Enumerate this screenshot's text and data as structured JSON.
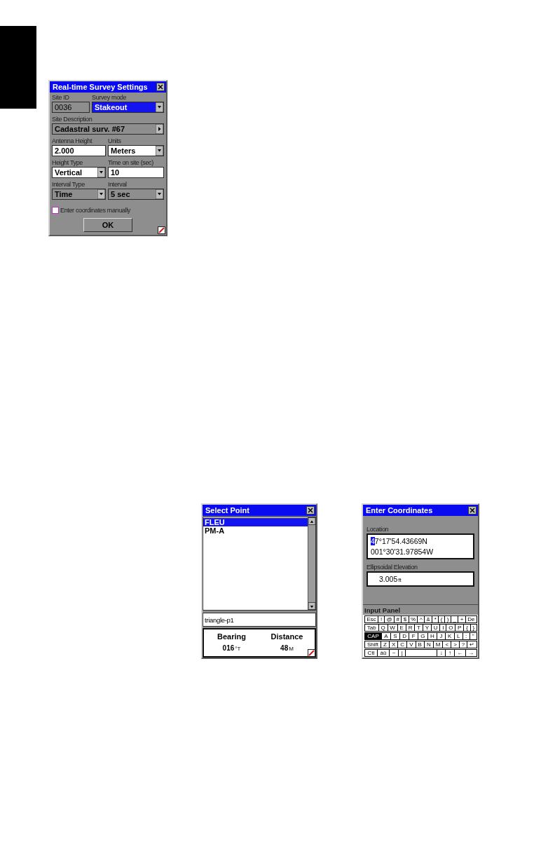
{
  "survey_settings": {
    "title": "Real-time Survey Settings",
    "rows": [
      [
        {
          "label": "Site ID",
          "value": "0036",
          "kind": "text",
          "disabled": true,
          "focused": false
        },
        {
          "label": "Survey mode",
          "value": "Stakeout",
          "kind": "dropdown",
          "disabled": false,
          "focused": true
        }
      ],
      [
        {
          "label": "Site Description",
          "value": "Cadastral surv. #67",
          "kind": "picker",
          "disabled": true,
          "focused": false
        }
      ],
      [
        {
          "label": "Antenna Height",
          "value": "2.000",
          "kind": "text",
          "disabled": false,
          "focused": false
        },
        {
          "label": "Units",
          "value": "Meters",
          "kind": "dropdown",
          "disabled": false,
          "focused": false
        }
      ],
      [
        {
          "label": "Height Type",
          "value": "Vertical",
          "kind": "dropdown",
          "disabled": false,
          "focused": false
        },
        {
          "label": "Time on site (sec)",
          "value": "10",
          "kind": "text",
          "disabled": false,
          "focused": false
        }
      ],
      [
        {
          "label": "Interval Type",
          "value": "Time",
          "kind": "dropdown",
          "disabled": true,
          "focused": false
        },
        {
          "label": "Interval",
          "value": "5 sec",
          "kind": "dropdown",
          "disabled": true,
          "focused": false
        }
      ]
    ],
    "checkbox": {
      "label": "Enter coordinates manually",
      "checked": false
    },
    "button": "OK"
  },
  "select_point": {
    "title": "Select Point",
    "points": [
      {
        "label": "FLEU",
        "selected": true
      },
      {
        "label": "PM-A",
        "selected": false
      }
    ],
    "name_field": {
      "value": "triangle-p1"
    },
    "readouts": [
      {
        "label": "Bearing",
        "value": "016",
        "unit": "°T"
      },
      {
        "label": "Distance",
        "value": "48",
        "unit": "M"
      }
    ]
  },
  "enter_coordinates": {
    "title": "Enter Coordinates",
    "location": {
      "label": "Location",
      "lines": [
        {
          "text": "47°17'54.43669N",
          "cursor": true
        },
        {
          "text": "001°30'31.97854W",
          "cursor": false
        }
      ]
    },
    "elevation": {
      "label": "Ellipsoidal Elevation",
      "value": "3.005",
      "unit": "ft"
    },
    "input_panel": {
      "title": "Input Panel",
      "key_rows": [
        {
          "keys": [
            {
              "kind": "key",
              "label": "Esc",
              "selected": false
            },
            {
              "kind": "key",
              "label": "!",
              "selected": false
            },
            {
              "kind": "key",
              "label": "@",
              "selected": false
            },
            {
              "kind": "key",
              "label": "#",
              "selected": false
            },
            {
              "kind": "key",
              "label": "$",
              "selected": false
            },
            {
              "kind": "key",
              "label": "%",
              "selected": false
            },
            {
              "kind": "key",
              "label": "^",
              "selected": false
            },
            {
              "kind": "key",
              "label": "&",
              "selected": false
            },
            {
              "kind": "key",
              "label": "*",
              "selected": false
            },
            {
              "kind": "key",
              "label": "(",
              "selected": false
            },
            {
              "kind": "key",
              "label": ")",
              "selected": false
            },
            {
              "kind": "key",
              "label": "_",
              "selected": false
            },
            {
              "kind": "key",
              "label": "+",
              "selected": false
            },
            {
              "kind": "key",
              "label": "De",
              "selected": false
            }
          ]
        },
        {
          "keys": [
            {
              "kind": "key",
              "label": "Tab",
              "selected": false
            },
            {
              "kind": "key",
              "label": "Q",
              "selected": false
            },
            {
              "kind": "key",
              "label": "W",
              "selected": false
            },
            {
              "kind": "key",
              "label": "E",
              "selected": false
            },
            {
              "kind": "key",
              "label": "R",
              "selected": false
            },
            {
              "kind": "key",
              "label": "T",
              "selected": false
            },
            {
              "kind": "key",
              "label": "Y",
              "selected": false
            },
            {
              "kind": "key",
              "label": "U",
              "selected": false
            },
            {
              "kind": "key",
              "label": "I",
              "selected": false
            },
            {
              "kind": "key",
              "label": "O",
              "selected": false
            },
            {
              "kind": "key",
              "label": "P",
              "selected": false
            },
            {
              "kind": "key",
              "label": "{",
              "selected": false
            },
            {
              "kind": "key",
              "label": "}",
              "selected": false
            }
          ]
        },
        {
          "keys": [
            {
              "kind": "key",
              "label": "CAP",
              "selected": true
            },
            {
              "kind": "key",
              "label": "A",
              "selected": false
            },
            {
              "kind": "key",
              "label": "S",
              "selected": false
            },
            {
              "kind": "key",
              "label": "D",
              "selected": false
            },
            {
              "kind": "key",
              "label": "F",
              "selected": false
            },
            {
              "kind": "key",
              "label": "G",
              "selected": false
            },
            {
              "kind": "key",
              "label": "H",
              "selected": false
            },
            {
              "kind": "key",
              "label": "J",
              "selected": false
            },
            {
              "kind": "key",
              "label": "K",
              "selected": false
            },
            {
              "kind": "key",
              "label": "L",
              "selected": false
            },
            {
              "kind": "key",
              "label": ":",
              "selected": false
            },
            {
              "kind": "key",
              "label": "\"",
              "selected": false
            }
          ]
        },
        {
          "keys": [
            {
              "kind": "key",
              "label": "Shift",
              "selected": false
            },
            {
              "kind": "key",
              "label": "Z",
              "selected": false
            },
            {
              "kind": "key",
              "label": "X",
              "selected": false
            },
            {
              "kind": "key",
              "label": "C",
              "selected": false
            },
            {
              "kind": "key",
              "label": "V",
              "selected": false
            },
            {
              "kind": "key",
              "label": "B",
              "selected": false
            },
            {
              "kind": "key",
              "label": "N",
              "selected": false
            },
            {
              "kind": "key",
              "label": "M",
              "selected": false
            },
            {
              "kind": "key",
              "label": "<",
              "selected": false
            },
            {
              "kind": "key",
              "label": ">",
              "selected": false
            },
            {
              "kind": "key",
              "label": "?",
              "selected": false
            },
            {
              "kind": "key",
              "label": "↵",
              "selected": false
            }
          ]
        },
        {
          "keys": [
            {
              "kind": "key",
              "label": "Ctl",
              "selected": false
            },
            {
              "kind": "key",
              "label": "áü",
              "selected": false
            },
            {
              "kind": "key",
              "label": "~",
              "selected": false
            },
            {
              "kind": "key",
              "label": "|",
              "selected": false
            },
            {
              "kind": "space",
              "selected": false
            },
            {
              "kind": "key",
              "label": "↓",
              "selected": false
            },
            {
              "kind": "key",
              "label": "↑",
              "selected": false
            },
            {
              "kind": "key",
              "label": "←",
              "selected": false
            },
            {
              "kind": "key",
              "label": "→",
              "selected": false
            }
          ]
        }
      ]
    }
  }
}
